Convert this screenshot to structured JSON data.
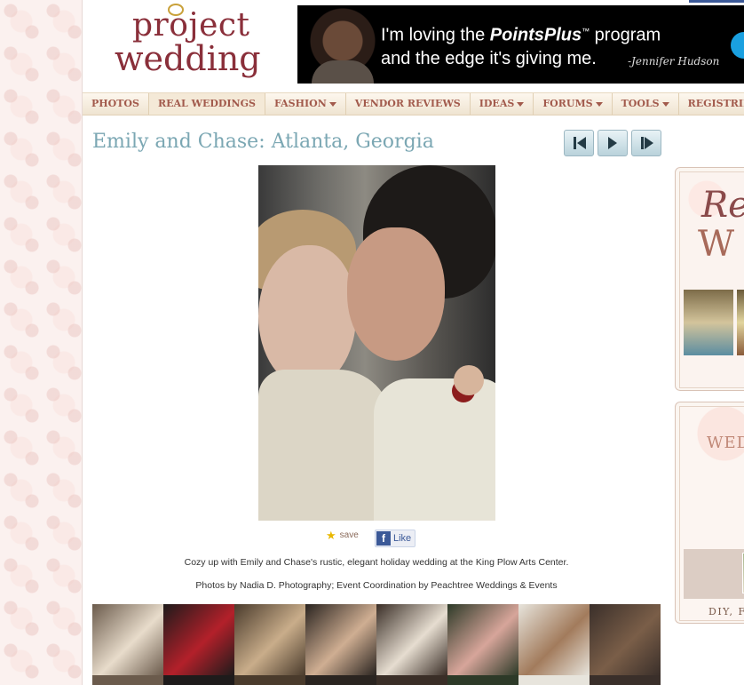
{
  "site": {
    "logo_line1": "project",
    "logo_line2": "wedding"
  },
  "ad": {
    "line1_prefix": "I'm loving the ",
    "line1_brand": "PointsPlus",
    "line1_tm": "™",
    "line1_suffix": " program",
    "line2": "and the edge it's giving me.",
    "signature": "-Jennifer Hudson"
  },
  "nav": {
    "items": [
      {
        "label": "PHOTOS",
        "dropdown": false
      },
      {
        "label": "REAL WEDDINGS",
        "dropdown": false
      },
      {
        "label": "FASHION",
        "dropdown": true
      },
      {
        "label": "VENDOR REVIEWS",
        "dropdown": false
      },
      {
        "label": "IDEAS",
        "dropdown": true
      },
      {
        "label": "FORUMS",
        "dropdown": true
      },
      {
        "label": "TOOLS",
        "dropdown": true
      },
      {
        "label": "REGISTRIES",
        "dropdown": false
      }
    ]
  },
  "gallery": {
    "title": "Emily and Chase: Atlanta, Georgia",
    "save_label": "save",
    "like_label": "Like",
    "caption": "Cozy up with Emily and Chase's rustic, elegant holiday wedding at the King Plow Arts Center.",
    "credits": "Photos by Nadia D. Photography; Event Coordination by Peachtree Weddings & Events"
  },
  "thumbnails": [
    {
      "name": "couple-kiss",
      "colors": [
        "#6b5b4c",
        "#e8dccb"
      ]
    },
    {
      "name": "red-shoes",
      "colors": [
        "#1e1b1b",
        "#b3202a"
      ]
    },
    {
      "name": "bridesmaids-dressing",
      "colors": [
        "#4a3b2c",
        "#c9ad8a"
      ]
    },
    {
      "name": "bride-portrait",
      "colors": [
        "#2a2420",
        "#cfae92"
      ]
    },
    {
      "name": "garter",
      "colors": [
        "#3a2e27",
        "#e6ddd0"
      ]
    },
    {
      "name": "bouquet",
      "colors": [
        "#2d3a28",
        "#d7a59a"
      ]
    },
    {
      "name": "boutonniere",
      "colors": [
        "#e7e4dc",
        "#a27b5c"
      ]
    },
    {
      "name": "bridal-party",
      "colors": [
        "#3a2f2a",
        "#7a5e48"
      ]
    }
  ],
  "sidebar": {
    "ad1_text_a": "Re",
    "ad1_text_b": "W",
    "ad2_text": "WED",
    "ad2_caption": "DIY, F"
  }
}
